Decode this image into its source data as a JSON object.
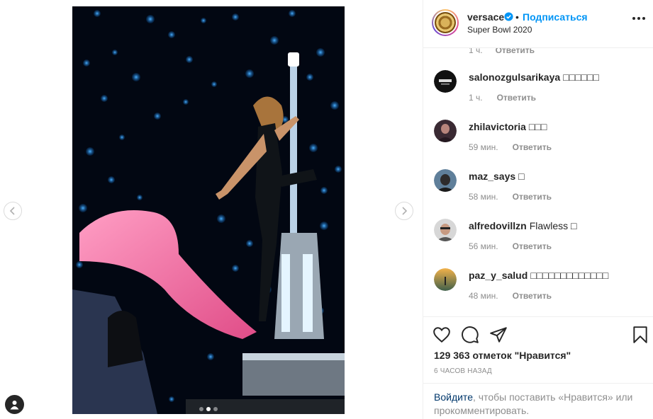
{
  "post": {
    "username": "versace",
    "follow_label": "Подписаться",
    "bullet": "•",
    "location": "Super Bowl 2020",
    "carousel": {
      "dots": 3,
      "active": 1
    }
  },
  "comments_partial": {
    "time": "1 ч.",
    "reply": "Ответить"
  },
  "comments": [
    {
      "user": "salonozgulsarikaya",
      "text": "□□□□□□",
      "time": "1 ч.",
      "reply": "Ответить",
      "avatar": "salon-logo"
    },
    {
      "user": "zhilavictoria",
      "text": "□□□",
      "time": "59 мин.",
      "reply": "Ответить",
      "avatar": "portrait"
    },
    {
      "user": "maz_says",
      "text": "□",
      "time": "58 мин.",
      "reply": "Ответить",
      "avatar": "portrait"
    },
    {
      "user": "alfredovillzn",
      "text": "Flawless □",
      "time": "56 мин.",
      "reply": "Ответить",
      "avatar": "portrait"
    },
    {
      "user": "paz_y_salud",
      "text": "□□□□□□□□□□□□□",
      "time": "48 мин.",
      "reply": "Ответить",
      "avatar": "sunset"
    }
  ],
  "actions": {
    "like_icon": "heart-icon",
    "comment_icon": "comment-icon",
    "share_icon": "paper-plane-icon",
    "save_icon": "bookmark-icon",
    "likes_text": "129 363 отметок \"Нравится\"",
    "time_ago": "6 часов назад"
  },
  "login_prompt": {
    "link": "Войдите",
    "rest": ", чтобы поставить «Нравится» или прокомментировать."
  },
  "colors": {
    "accent": "#0095f6",
    "text": "#262626",
    "muted": "#8e8e8e",
    "link": "#00376b"
  }
}
